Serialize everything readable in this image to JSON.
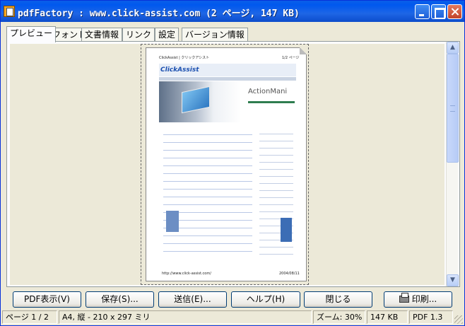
{
  "window": {
    "title": "pdfFactory : www.click-assist.com (2 ページ, 147 KB)"
  },
  "tabs": [
    {
      "label": "プレビュー"
    },
    {
      "label": "フォント"
    },
    {
      "label": "文書情報"
    },
    {
      "label": "リンク"
    },
    {
      "label": "設定"
    },
    {
      "label": "バージョン情報"
    }
  ],
  "preview": {
    "page_header_left": "ClickAssist | クリックアシスト",
    "page_header_right": "1/2 ページ",
    "site_logo": "ClickAssist",
    "banner_text": "ActionMani",
    "page_footer_left": "http://www.click-assist.com/",
    "page_footer_right": "2004/08/11"
  },
  "buttons": {
    "pdf_view": "PDF表示(V)",
    "save": "保存(S)...",
    "send": "送信(E)...",
    "help": "ヘルプ(H)",
    "close": "閉じる",
    "print": "印刷..."
  },
  "status": {
    "page": "ページ 1 / 2",
    "paper": "A4, 縦 - 210 x 297 ミリ",
    "zoom": "ズーム: 30%",
    "size": "147 KB",
    "pdf_version": "PDF 1.3"
  },
  "colors": {
    "titlebar": "#0058EE",
    "face": "#ECE9D8",
    "link_blue": "#1A4FB0"
  },
  "icons": [
    "pdffactory-app-icon",
    "minimize-icon",
    "maximize-icon",
    "close-icon",
    "printer-icon",
    "scroll-up-arrow-icon",
    "scroll-down-arrow-icon"
  ]
}
